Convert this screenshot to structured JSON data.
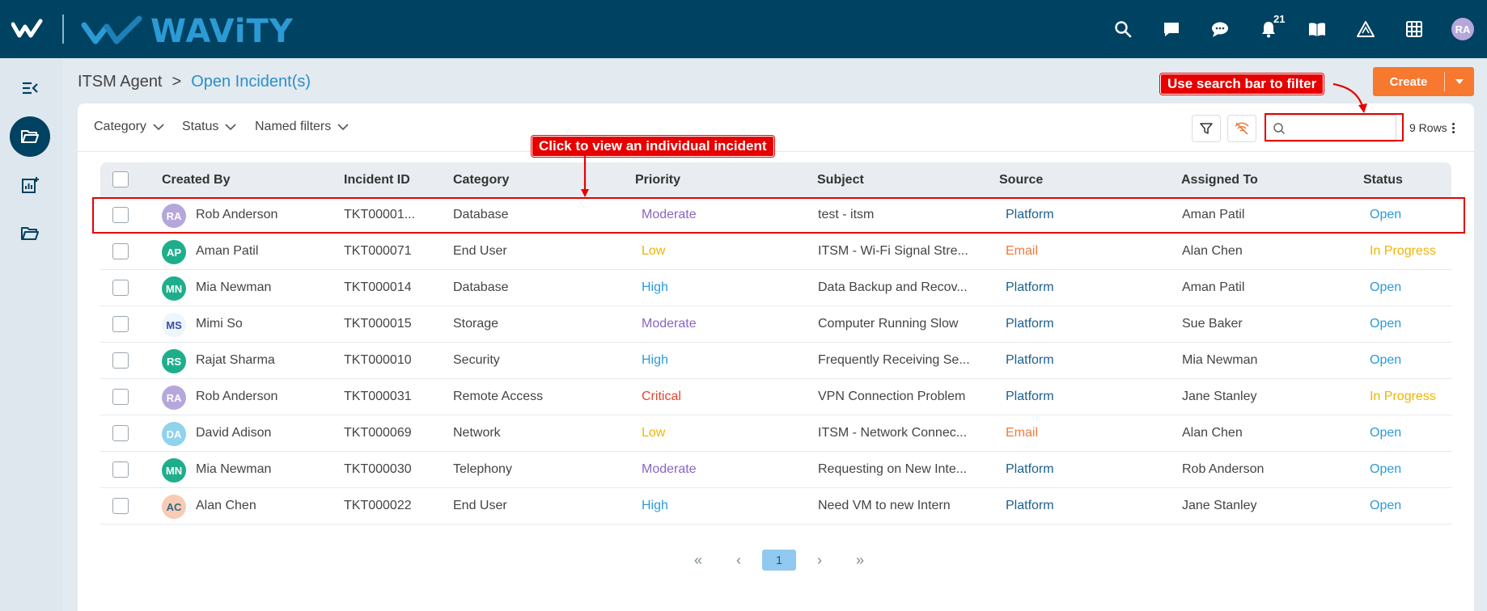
{
  "header": {
    "brand": "WAViTY",
    "notification_count": "21",
    "user_initials": "RA"
  },
  "breadcrumb": {
    "root": "ITSM Agent",
    "separator": ">",
    "current": "Open Incident(s)"
  },
  "actions": {
    "create_label": "Create"
  },
  "filters": {
    "category": "Category",
    "status": "Status",
    "named_filters": "Named filters",
    "search_placeholder": "",
    "rows_label": "9 Rows"
  },
  "table": {
    "columns": [
      "Created By",
      "Incident ID",
      "Category",
      "Priority",
      "Subject",
      "Source",
      "Assigned To",
      "Status"
    ],
    "rows": [
      {
        "initials": "RA",
        "avatar_color": "#b6a7da",
        "avatar_text_color": "#ffffff",
        "created_by": "Rob Anderson",
        "incident_id": "TKT00001...",
        "category": "Database",
        "priority": "Moderate",
        "subject": "test - itsm",
        "source": "Platform",
        "assigned_to": "Aman Patil",
        "status": "Open"
      },
      {
        "initials": "AP",
        "avatar_color": "#1fae8c",
        "avatar_text_color": "#ffffff",
        "created_by": "Aman Patil",
        "incident_id": "TKT000071",
        "category": "End User",
        "priority": "Low",
        "subject": "ITSM - Wi-Fi Signal Stre...",
        "source": "Email",
        "assigned_to": "Alan Chen",
        "status": "In Progress"
      },
      {
        "initials": "MN",
        "avatar_color": "#1fae8c",
        "avatar_text_color": "#ffffff",
        "created_by": "Mia Newman",
        "incident_id": "TKT000014",
        "category": "Database",
        "priority": "High",
        "subject": "Data Backup and Recov...",
        "source": "Platform",
        "assigned_to": "Aman Patil",
        "status": "Open"
      },
      {
        "initials": "MS",
        "avatar_color": "#eef5fb",
        "avatar_text_color": "#3a4aa8",
        "created_by": "Mimi So",
        "incident_id": "TKT000015",
        "category": "Storage",
        "priority": "Moderate",
        "subject": "Computer Running Slow",
        "source": "Platform",
        "assigned_to": "Sue Baker",
        "status": "Open"
      },
      {
        "initials": "RS",
        "avatar_color": "#1fae8c",
        "avatar_text_color": "#ffffff",
        "created_by": "Rajat Sharma",
        "incident_id": "TKT000010",
        "category": "Security",
        "priority": "High",
        "subject": "Frequently Receiving Se...",
        "source": "Platform",
        "assigned_to": "Mia Newman",
        "status": "Open"
      },
      {
        "initials": "RA",
        "avatar_color": "#b6a7da",
        "avatar_text_color": "#ffffff",
        "created_by": "Rob Anderson",
        "incident_id": "TKT000031",
        "category": "Remote Access",
        "priority": "Critical",
        "subject": "VPN Connection Problem",
        "source": "Platform",
        "assigned_to": "Jane Stanley",
        "status": "In Progress"
      },
      {
        "initials": "DA",
        "avatar_color": "#8fd3ec",
        "avatar_text_color": "#ffffff",
        "created_by": "David Adison",
        "incident_id": "TKT000069",
        "category": "Network",
        "priority": "Low",
        "subject": "ITSM - Network Connec...",
        "source": "Email",
        "assigned_to": "Alan Chen",
        "status": "Open"
      },
      {
        "initials": "MN",
        "avatar_color": "#1fae8c",
        "avatar_text_color": "#ffffff",
        "created_by": "Mia Newman",
        "incident_id": "TKT000030",
        "category": "Telephony",
        "priority": "Moderate",
        "subject": "Requesting on New Inte...",
        "source": "Platform",
        "assigned_to": "Rob Anderson",
        "status": "Open"
      },
      {
        "initials": "AC",
        "avatar_color": "#f7cbb4",
        "avatar_text_color": "#2a6c8a",
        "created_by": "Alan Chen",
        "incident_id": "TKT000022",
        "category": "End User",
        "priority": "High",
        "subject": "Need VM to new Intern",
        "source": "Platform",
        "assigned_to": "Jane Stanley",
        "status": "Open"
      }
    ]
  },
  "pagination": {
    "first": "«",
    "prev": "‹",
    "current": "1",
    "next": "›",
    "last": "»"
  },
  "annotations": {
    "search_tip": "Use search bar to filter",
    "row_tip": "Click to view an individual incident"
  },
  "icons": {
    "topbar": [
      "search-icon",
      "chat-icon",
      "comment-icon",
      "bell-icon",
      "book-icon",
      "warning-icon",
      "grid-icon"
    ],
    "rail": [
      "collapse-icon",
      "folder-open-icon",
      "report-add-icon",
      "folder-icon"
    ]
  },
  "colors": {
    "header_bg": "#004261",
    "brand_blue": "#2b9bd6",
    "create_orange": "#f7782f",
    "annotation_red": "#e60000"
  }
}
